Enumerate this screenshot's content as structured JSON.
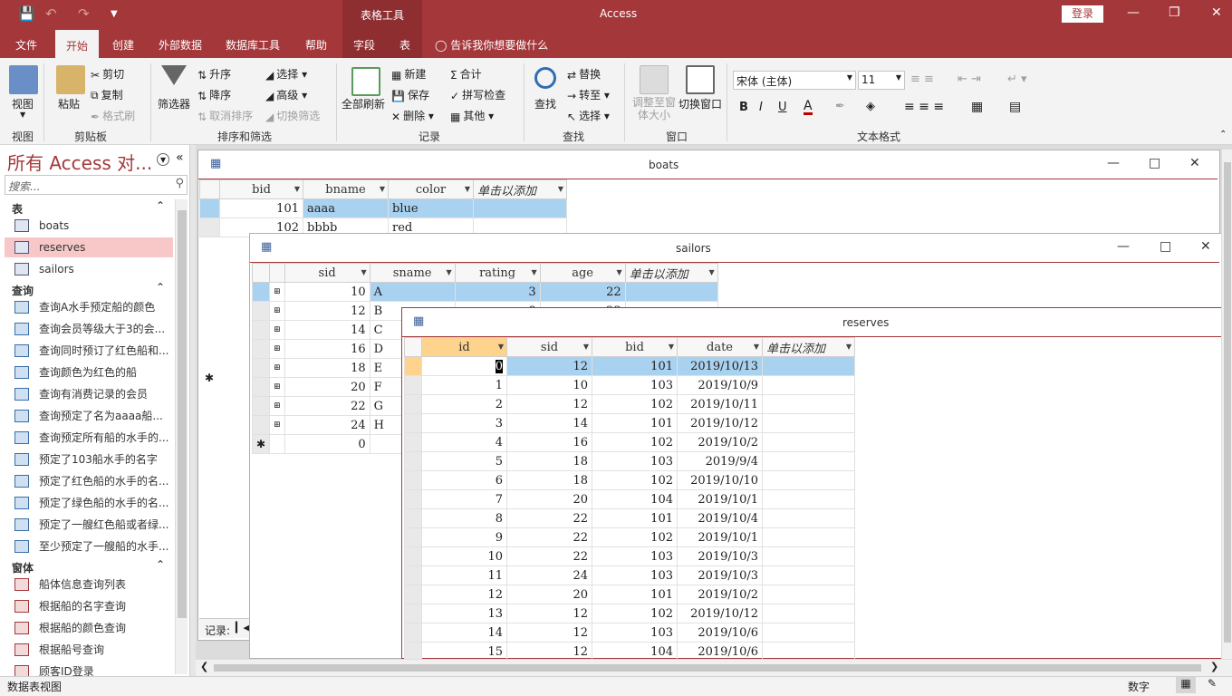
{
  "app": {
    "title": "Access",
    "tool_tab": "表格工具",
    "login": "登录"
  },
  "ribbon_tabs": [
    "文件",
    "开始",
    "创建",
    "外部数据",
    "数据库工具",
    "帮助",
    "字段",
    "表"
  ],
  "tell_me": "告诉我你想要做什么",
  "ribbon": {
    "view": {
      "label": "视图",
      "group": "视图"
    },
    "clipboard": {
      "paste": "粘贴",
      "cut": "剪切",
      "copy": "复制",
      "format_painter": "格式刷",
      "group": "剪贴板"
    },
    "sort_filter": {
      "filter": "筛选器",
      "asc": "升序",
      "desc": "降序",
      "clear_sort": "取消排序",
      "select": "选择",
      "advanced": "高级",
      "toggle_filter": "切换筛选",
      "group": "排序和筛选"
    },
    "records": {
      "refresh": "全部刷新",
      "new": "新建",
      "save": "保存",
      "delete": "删除",
      "total": "合计",
      "spelling": "拼写检查",
      "other": "其他",
      "group": "记录"
    },
    "find": {
      "find": "查找",
      "replace": "替换",
      "goto": "转至",
      "select": "选择",
      "group": "查找"
    },
    "window": {
      "resize": "调整至窗体大小",
      "switch": "切换窗口",
      "group": "窗口"
    },
    "text_format": {
      "font": "宋体 (主体)",
      "size": "11",
      "bold": "B",
      "italic": "I",
      "underline": "U",
      "group": "文本格式"
    }
  },
  "nav": {
    "title": "所有 Access 对...",
    "search_placeholder": "搜索...",
    "cat_tables": "表",
    "tables": [
      "boats",
      "reserves",
      "sailors"
    ],
    "cat_queries": "查询",
    "queries": [
      "查询A水手预定船的颜色",
      "查询会员等级大于3的会...",
      "查询同时预订了红色船和...",
      "查询颜色为红色的船",
      "查询有消费记录的会员",
      "查询预定了名为aaaa船...",
      "查询预定所有船的水手的...",
      "预定了103船水手的名字",
      "预定了红色船的水手的名...",
      "预定了绿色船的水手的名...",
      "预定了一艘红色船或者绿...",
      "至少预定了一艘船的水手..."
    ],
    "cat_forms": "窗体",
    "forms": [
      "船体信息查询列表",
      "根据船的名字查询",
      "根据船的颜色查询",
      "根据船号查询",
      "顾客ID登录"
    ]
  },
  "boats": {
    "title": "boats",
    "columns": [
      "bid",
      "bname",
      "color",
      "单击以添加"
    ],
    "rows": [
      [
        "101",
        "aaaa",
        "blue"
      ],
      [
        "102",
        "bbbb",
        "red"
      ]
    ],
    "record_label": "记录:"
  },
  "sailors": {
    "title": "sailors",
    "columns": [
      "sid",
      "sname",
      "rating",
      "age",
      "单击以添加"
    ],
    "rows": [
      [
        "10",
        "A",
        "3",
        "22"
      ],
      [
        "12",
        "B",
        "8",
        "23"
      ],
      [
        "14",
        "C",
        "",
        ""
      ],
      [
        "16",
        "D",
        "",
        ""
      ],
      [
        "18",
        "E",
        "",
        ""
      ],
      [
        "20",
        "F",
        "",
        ""
      ],
      [
        "22",
        "G",
        "",
        ""
      ],
      [
        "24",
        "H",
        "",
        ""
      ]
    ],
    "new_row": "0"
  },
  "reserves": {
    "title": "reserves",
    "columns": [
      "id",
      "sid",
      "bid",
      "date",
      "单击以添加"
    ],
    "rows": [
      [
        "0",
        "12",
        "101",
        "2019/10/13"
      ],
      [
        "1",
        "10",
        "103",
        "2019/10/9"
      ],
      [
        "2",
        "12",
        "102",
        "2019/10/11"
      ],
      [
        "3",
        "14",
        "101",
        "2019/10/12"
      ],
      [
        "4",
        "16",
        "102",
        "2019/10/2"
      ],
      [
        "5",
        "18",
        "103",
        "2019/9/4"
      ],
      [
        "6",
        "18",
        "102",
        "2019/10/10"
      ],
      [
        "7",
        "20",
        "104",
        "2019/10/1"
      ],
      [
        "8",
        "22",
        "101",
        "2019/10/4"
      ],
      [
        "9",
        "22",
        "102",
        "2019/10/1"
      ],
      [
        "10",
        "22",
        "103",
        "2019/10/3"
      ],
      [
        "11",
        "24",
        "103",
        "2019/10/3"
      ],
      [
        "12",
        "20",
        "101",
        "2019/10/2"
      ],
      [
        "13",
        "12",
        "102",
        "2019/10/12"
      ],
      [
        "14",
        "12",
        "103",
        "2019/10/6"
      ],
      [
        "15",
        "12",
        "104",
        "2019/10/6"
      ]
    ]
  },
  "status": {
    "left": "数据表视图",
    "right": "数字"
  }
}
